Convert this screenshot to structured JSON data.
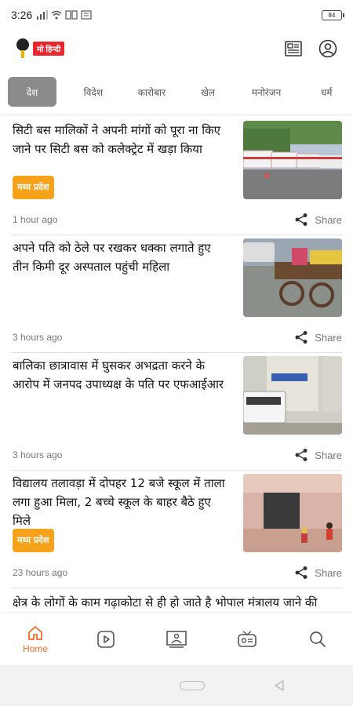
{
  "status": {
    "time": "3:26",
    "battery": "84"
  },
  "header": {
    "logo_text": "मो हिन्दी"
  },
  "tabs": [
    {
      "label": "देश",
      "active": true
    },
    {
      "label": "विदेश"
    },
    {
      "label": "कारोबार"
    },
    {
      "label": "खेल"
    },
    {
      "label": "मनोरंजन"
    },
    {
      "label": "धर्म"
    }
  ],
  "articles": [
    {
      "title": "सिटी बस मालिकों ने अपनी मांगों को पूरा ना किए जाने पर सिटी बस को कलेक्ट्रेट में खड़ा किया",
      "tag": "मध्य प्रदेश",
      "time": "1 hour ago",
      "share": "Share"
    },
    {
      "title": "अपने पति को ठेले पर रखकर धक्का लगाते हुए तीन किमी दूर अस्पताल पहुंची महिला",
      "time": "3 hours ago",
      "share": "Share"
    },
    {
      "title": "बालिका छात्रावास में घुसकर अभद्रता करने के आरोप में जनपद उपाध्यक्ष के पति पर एफआईआर",
      "time": "3 hours ago",
      "share": "Share"
    },
    {
      "title": " विद्यालय तलावड़ा में दोपहर 12 बजे स्कूल में ताला लगा हुआ मिला, 2 बच्चे स्कूल के बाहर बैठे हुए मिले",
      "tag": "मध्य प्रदेश",
      "time": "23 hours ago",
      "share": "Share"
    },
    {
      "title": " क्षेत्र के लोगों के काम गढ़ाकोटा से ही हो जाते है भोपाल मंत्रालय जाने की आवश्यकता नहीं, गोपाल भार्गव ने रहली, विधानसभा क्षेत्र में कई"
    }
  ],
  "nav": {
    "home_label": "Home"
  },
  "colors": {
    "accent": "#ef6c2a",
    "tag": "#f6a21b",
    "active_tab": "#8b8b8b"
  }
}
